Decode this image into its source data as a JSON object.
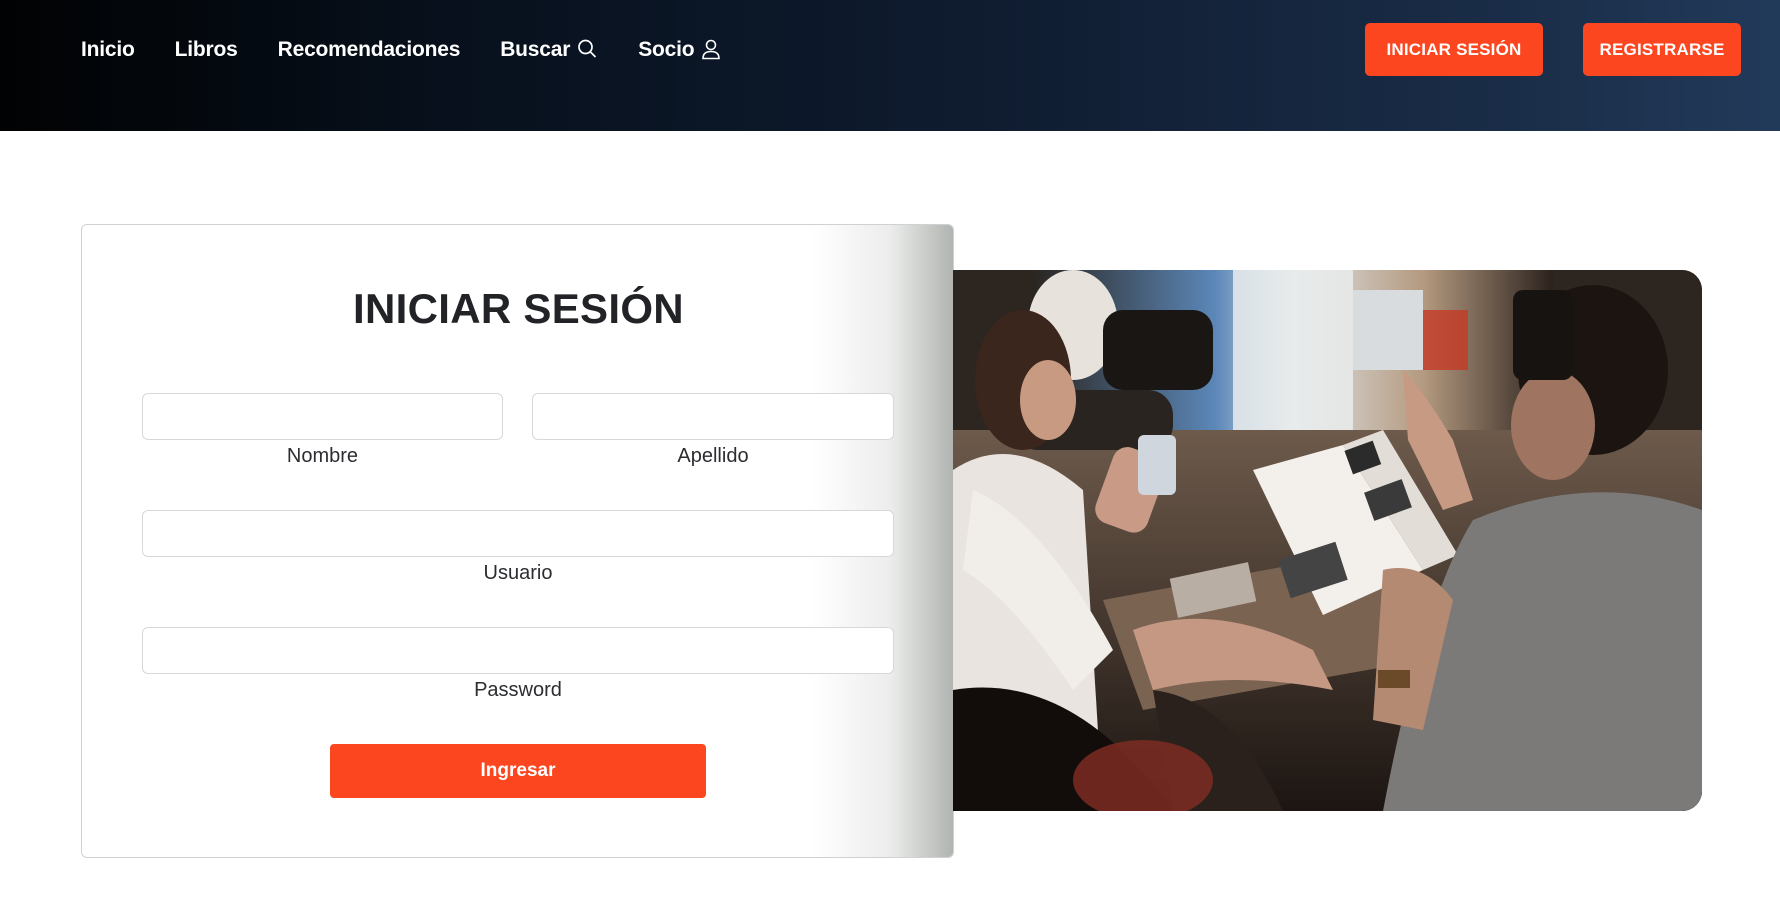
{
  "nav": {
    "links": [
      {
        "label": "Inicio"
      },
      {
        "label": "Libros"
      },
      {
        "label": "Recomendaciones"
      },
      {
        "label": "Buscar",
        "icon": "search-icon"
      },
      {
        "label": "Socio",
        "icon": "user-icon"
      }
    ],
    "login_label": "INICIAR SESIÓN",
    "register_label": "REGISTRARSE"
  },
  "form": {
    "title": "INICIAR SESIÓN",
    "fields": {
      "nombre": {
        "label": "Nombre",
        "value": ""
      },
      "apellido": {
        "label": "Apellido",
        "value": ""
      },
      "usuario": {
        "label": "Usuario",
        "value": ""
      },
      "password": {
        "label": "Password",
        "value": ""
      }
    },
    "submit_label": "Ingresar"
  },
  "colors": {
    "accent": "#fc4620",
    "nav_dark": "#010203",
    "nav_light": "#223a5a"
  }
}
